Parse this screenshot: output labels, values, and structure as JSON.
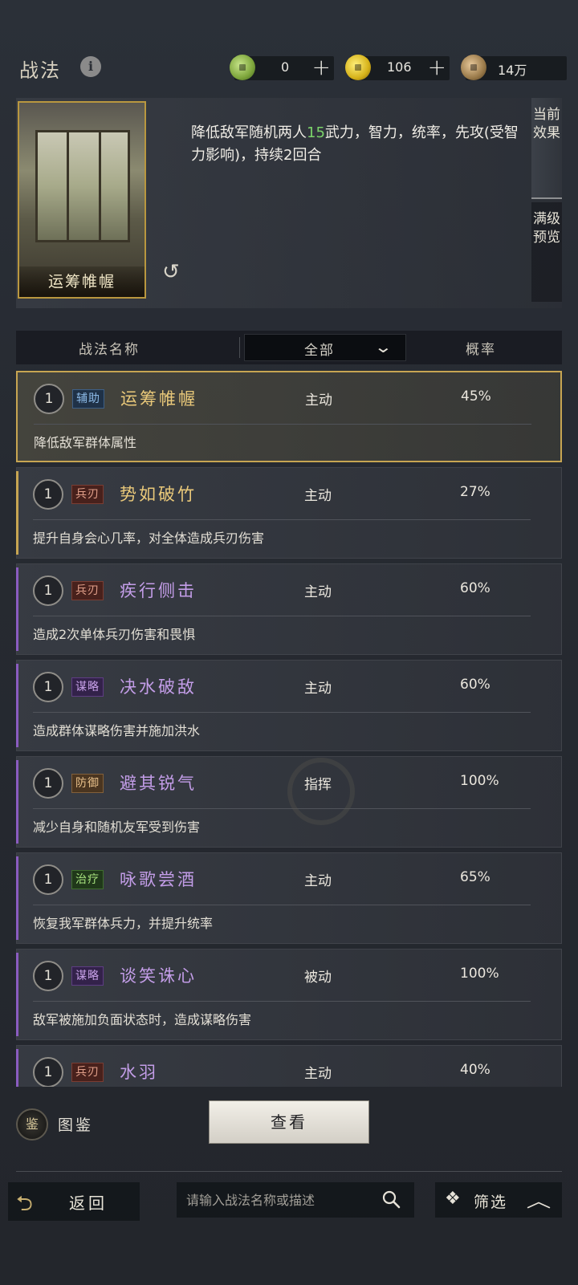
{
  "header": {
    "title": "战法",
    "info_icon": "info-icon",
    "resources": [
      {
        "icon": "jade-coin-icon",
        "value": "0",
        "add": "+"
      },
      {
        "icon": "gold-coin-icon",
        "value": "106",
        "add": "+"
      },
      {
        "icon": "copper-coin-icon",
        "value": "14万"
      }
    ]
  },
  "detail": {
    "card_name": "运筹帷幄",
    "description_before": "降低敌军随机两人",
    "description_highlight": "15",
    "description_after": "武力，智力，统率，先攻(受智力影响)，持续2回合",
    "highlight_color": "#7bd36a",
    "tabs": [
      {
        "label": "当前效果",
        "active": true
      },
      {
        "label": "满级预览",
        "active": false
      }
    ]
  },
  "list_header": {
    "col_name": "战法名称",
    "filter_value": "全部",
    "col_rate": "概率"
  },
  "tactics": [
    {
      "level": "1",
      "tag": "辅助",
      "tag_type": "fuzhu",
      "name": "运筹帷幄",
      "name_color": "gold",
      "kind": "主动",
      "rate": "45%",
      "desc": "降低敌军群体属性",
      "selected": true
    },
    {
      "level": "1",
      "tag": "兵刃",
      "tag_type": "bingren",
      "name": "势如破竹",
      "name_color": "gold",
      "kind": "主动",
      "rate": "27%",
      "desc": "提升自身会心几率，对全体造成兵刃伤害",
      "selected": false
    },
    {
      "level": "1",
      "tag": "兵刃",
      "tag_type": "bingren",
      "name": "疾行侧击",
      "name_color": "purple",
      "kind": "主动",
      "rate": "60%",
      "desc": "造成2次单体兵刃伤害和畏惧",
      "selected": false
    },
    {
      "level": "1",
      "tag": "谋略",
      "tag_type": "moulue",
      "name": "决水破敌",
      "name_color": "purple",
      "kind": "主动",
      "rate": "60%",
      "desc": "造成群体谋略伤害并施加洪水",
      "selected": false
    },
    {
      "level": "1",
      "tag": "防御",
      "tag_type": "fangyu",
      "name": "避其锐气",
      "name_color": "purple",
      "kind": "指挥",
      "rate": "100%",
      "desc": "减少自身和随机友军受到伤害",
      "selected": false
    },
    {
      "level": "1",
      "tag": "治疗",
      "tag_type": "zhiliao",
      "name": "咏歌尝酒",
      "name_color": "purple",
      "kind": "主动",
      "rate": "65%",
      "desc": "恢复我军群体兵力，并提升统率",
      "selected": false
    },
    {
      "level": "1",
      "tag": "谋略",
      "tag_type": "moulue",
      "name": "谈笑诛心",
      "name_color": "purple",
      "kind": "被动",
      "rate": "100%",
      "desc": "敌军被施加负面状态时，造成谋略伤害",
      "selected": false
    },
    {
      "level": "1",
      "tag": "兵刃",
      "tag_type": "bingren",
      "name": "水羽",
      "name_color": "purple",
      "kind": "主动",
      "rate": "40%",
      "desc": "",
      "selected": false
    }
  ],
  "bottom": {
    "album_label": "图鉴",
    "album_icon_text": "鉴",
    "view_button": "查看",
    "back_label": "返回",
    "search_placeholder": "请输入战法名称或描述",
    "filter_label": "筛选"
  },
  "colors": {
    "gold_border": "#c7a552",
    "purple_accent": "#8a5cc0"
  }
}
